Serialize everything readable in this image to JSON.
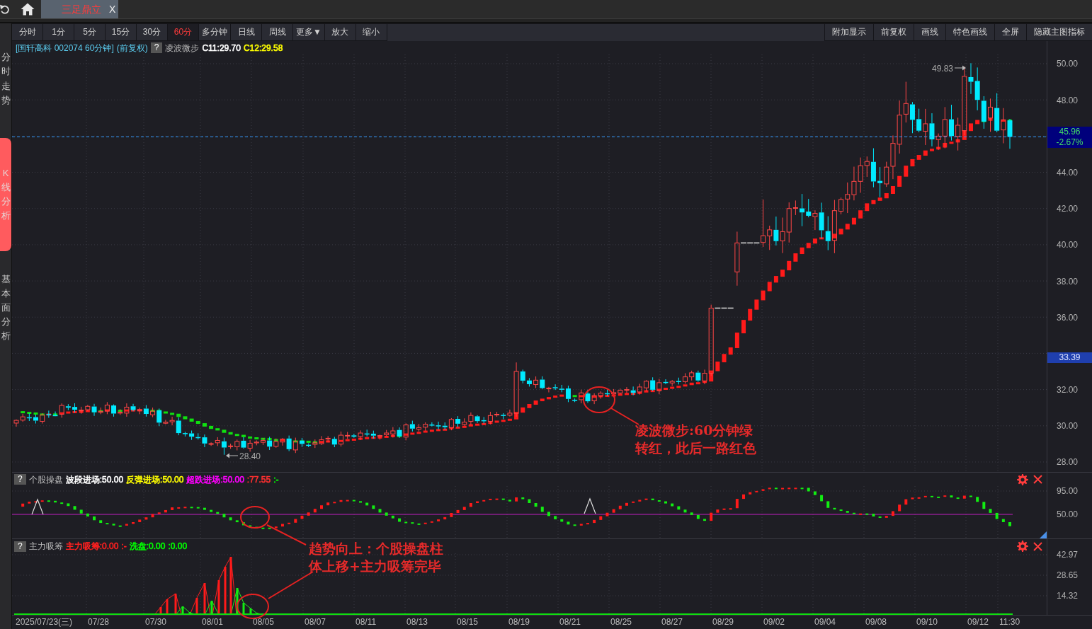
{
  "top_bar": {
    "tabs": [
      {
        "label": "三足鼎立",
        "close": "X",
        "selected": true
      }
    ]
  },
  "toolbar": {
    "periods": [
      {
        "label": "分时",
        "selected": false
      },
      {
        "label": "1分",
        "selected": false
      },
      {
        "label": "5分",
        "selected": false
      },
      {
        "label": "15分",
        "selected": false
      },
      {
        "label": "30分",
        "selected": false
      },
      {
        "label": "60分",
        "selected": true
      },
      {
        "label": "多分钟",
        "selected": false
      },
      {
        "label": "日线",
        "selected": false
      },
      {
        "label": "周线",
        "selected": false
      }
    ],
    "more": "更多▼",
    "zoom": [
      "放大",
      "缩小"
    ],
    "actions": [
      "附加显示",
      "前复权",
      "画线",
      "特色画线",
      "全屏",
      "隐藏主图指标"
    ]
  },
  "sidebar": {
    "items": [
      {
        "label": "分时走势",
        "selected": false
      },
      {
        "label": "K线分析",
        "selected": true
      },
      {
        "label": "基本面分析",
        "selected": false
      }
    ]
  },
  "main_chart": {
    "title": "[国轩高科 002074 60分钟]",
    "adjustment": "(前复权)",
    "help": "?",
    "indicator": "凌波微步",
    "legend": [
      {
        "label": "C11:29.70",
        "color": "#ffffff"
      },
      {
        "label": "C12:29.58",
        "color": "#ffff00"
      }
    ],
    "price_axis": [
      "50.00",
      "48.00",
      "44.00",
      "42.00",
      "40.00",
      "38.00",
      "36.00",
      "32.00",
      "30.00",
      "28.00"
    ],
    "last_price": "45.96",
    "change": "-2.67%",
    "cursor_price": "33.39",
    "high_label": "49.83",
    "low_label": "28.40",
    "note": [
      "凌波微步:60分钟绿",
      "转红，此后一路红色"
    ]
  },
  "indicator_1": {
    "help": "?",
    "name": "个股操盘",
    "legend": [
      {
        "label": "波段进场:50.00",
        "color": "#ffffff"
      },
      {
        "label": "反弹进场:50.00",
        "color": "#ffff00"
      },
      {
        "label": "超跌进场:50.00",
        "color": "#ff00ff"
      },
      {
        "label": ":77.55",
        "color": "#ff3030"
      },
      {
        "label": ":-",
        "color": "#00ff00"
      }
    ],
    "axis": [
      "95.00",
      "50.00"
    ]
  },
  "indicator_2": {
    "help": "?",
    "name": "主力吸筹",
    "legend": [
      {
        "label": "主力吸筹:0.00",
        "color": "#ff2020"
      },
      {
        "label": ":-",
        "color": "#ff2020"
      },
      {
        "label": "洗盘:0.00",
        "color": "#00ff00"
      },
      {
        "label": ":0.00",
        "color": "#00ff00"
      }
    ],
    "axis": [
      "42.97",
      "28.65",
      "14.32"
    ]
  },
  "note": [
    "趋势向上：个股操盘柱",
    "体上移+主力吸筹完毕"
  ],
  "date_axis": [
    "2025/07/23(三)",
    "07/28",
    "07/30",
    "08/01",
    "08/05",
    "08/07",
    "08/11",
    "08/13",
    "08/15",
    "08/19",
    "08/21",
    "08/25",
    "08/27",
    "08/29",
    "09/02",
    "09/04",
    "09/08",
    "09/10",
    "09/12",
    "11:30"
  ]
}
